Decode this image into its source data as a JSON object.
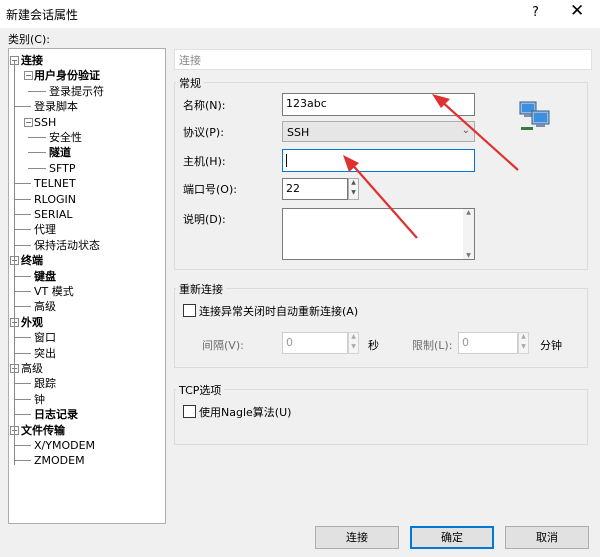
{
  "window": {
    "title": "新建会话属性",
    "help_label": "?",
    "close_label": "✕"
  },
  "category_label": "类别(C):",
  "tree": [
    {
      "label": "连接",
      "bold": true,
      "level": 0,
      "expanded": true
    },
    {
      "label": "用户身份验证",
      "bold": true,
      "level": 1,
      "expanded": true
    },
    {
      "label": "登录提示符",
      "bold": false,
      "level": 2
    },
    {
      "label": "登录脚本",
      "bold": false,
      "level": 1
    },
    {
      "label": "SSH",
      "bold": false,
      "level": 1,
      "expanded": true
    },
    {
      "label": "安全性",
      "bold": false,
      "level": 2
    },
    {
      "label": "隧道",
      "bold": true,
      "level": 2
    },
    {
      "label": "SFTP",
      "bold": false,
      "level": 2
    },
    {
      "label": "TELNET",
      "bold": false,
      "level": 1
    },
    {
      "label": "RLOGIN",
      "bold": false,
      "level": 1
    },
    {
      "label": "SERIAL",
      "bold": false,
      "level": 1
    },
    {
      "label": "代理",
      "bold": false,
      "level": 1
    },
    {
      "label": "保持活动状态",
      "bold": false,
      "level": 1
    },
    {
      "label": "终端",
      "bold": true,
      "level": 0,
      "expanded": true
    },
    {
      "label": "键盘",
      "bold": true,
      "level": 1
    },
    {
      "label": "VT 模式",
      "bold": false,
      "level": 1
    },
    {
      "label": "高级",
      "bold": false,
      "level": 1
    },
    {
      "label": "外观",
      "bold": true,
      "level": 0,
      "expanded": true
    },
    {
      "label": "窗口",
      "bold": false,
      "level": 1
    },
    {
      "label": "突出",
      "bold": false,
      "level": 1
    },
    {
      "label": "高级",
      "bold": false,
      "level": 0,
      "expanded": true
    },
    {
      "label": "跟踪",
      "bold": false,
      "level": 1
    },
    {
      "label": "钟",
      "bold": false,
      "level": 1
    },
    {
      "label": "日志记录",
      "bold": true,
      "level": 1
    },
    {
      "label": "文件传输",
      "bold": true,
      "level": 0,
      "expanded": true
    },
    {
      "label": "X/YMODEM",
      "bold": false,
      "level": 1
    },
    {
      "label": "ZMODEM",
      "bold": false,
      "level": 1
    }
  ],
  "section_header": "连接",
  "general": {
    "title": "常规",
    "name_label": "名称(N):",
    "name_value": "123abc",
    "protocol_label": "协议(P):",
    "protocol_value": "SSH",
    "host_label": "主机(H):",
    "host_value": "",
    "port_label": "端口号(O):",
    "port_value": "22",
    "desc_label": "说明(D):",
    "desc_value": ""
  },
  "reconnect": {
    "title": "重新连接",
    "checkbox_label": "连接异常关闭时自动重新连接(A)",
    "checked": false,
    "interval_label": "间隔(V):",
    "interval_value": "0",
    "interval_unit": "秒",
    "limit_label": "限制(L):",
    "limit_value": "0",
    "limit_unit": "分钟"
  },
  "tcp": {
    "title": "TCP选项",
    "checkbox_label": "使用Nagle算法(U)",
    "checked": false
  },
  "buttons": {
    "connect": "连接",
    "ok": "确定",
    "cancel": "取消"
  },
  "icon_names": [
    "computers-network-icon",
    "close-icon",
    "help-icon",
    "chevron-down-icon",
    "spin-up-icon",
    "spin-down-icon"
  ],
  "colors": {
    "accent": "#0078d7",
    "annotation_arrow": "#e03030"
  }
}
